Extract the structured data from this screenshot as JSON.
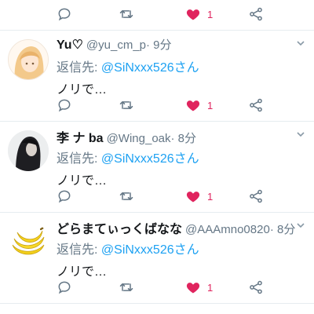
{
  "colors": {
    "like": "#e0245e",
    "link": "#1da1f2",
    "muted": "#657786",
    "divider": "#e6ecf0"
  },
  "top_actions": {
    "like_count": "1"
  },
  "tweets": [
    {
      "display_name": "Yu♡",
      "handle": "@yu_cm_p",
      "time": " · 9分",
      "reply_prefix": "返信先: ",
      "reply_handle": "@SiNxxx526さん",
      "text": "ノリで…",
      "like_count": "1",
      "avatar_icon": "anime-girl-avatar"
    },
    {
      "display_name": "李 ナ ba",
      "handle": "@Wing_oak",
      "time": " · 8分",
      "reply_prefix": "返信先: ",
      "reply_handle": "@SiNxxx526さん",
      "text": "ノリで…",
      "like_count": "1",
      "avatar_icon": "dark-hair-avatar"
    },
    {
      "display_name": "どらまてぃっくばなな",
      "handle": "@AAAmno0820",
      "time": " · 8分",
      "reply_prefix": "返信先: ",
      "reply_handle": "@SiNxxx526さん",
      "text": "ノリで…",
      "like_count": "1",
      "avatar_icon": "banana-avatar"
    }
  ]
}
